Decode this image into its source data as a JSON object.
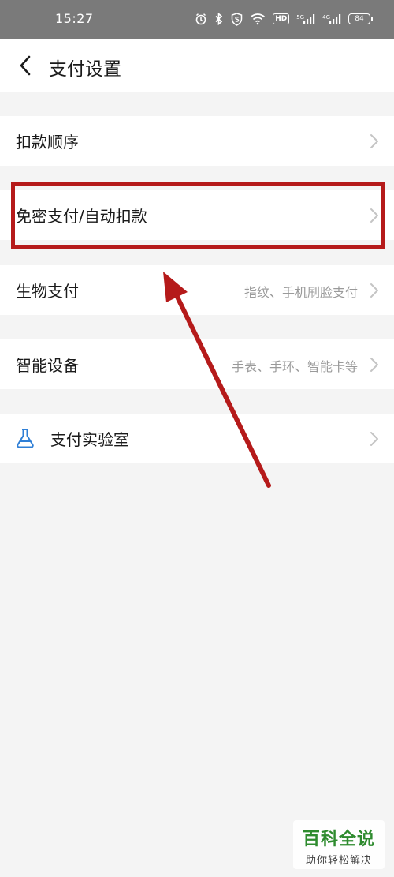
{
  "status_bar": {
    "time": "15:27",
    "network_5g": "5G",
    "network_4g": "4G",
    "hd": "HD",
    "battery": "84",
    "icons": [
      "alarm-icon",
      "bluetooth-icon",
      "shield-s-icon",
      "wifi-icon",
      "hd-icon",
      "signal-5g-icon",
      "signal-4g-icon",
      "battery-icon"
    ]
  },
  "header": {
    "title": "支付设置"
  },
  "settings": {
    "deduction_order": {
      "label": "扣款顺序"
    },
    "auto_pay": {
      "label": "免密支付/自动扣款"
    },
    "bio_pay": {
      "label": "生物支付",
      "detail": "指纹、手机刷脸支付"
    },
    "smart_devices": {
      "label": "智能设备",
      "detail": "手表、手环、智能卡等"
    },
    "pay_lab": {
      "label": "支付实验室",
      "icon": "flask-icon"
    }
  },
  "annotation": {
    "color": "#b51a1a"
  },
  "watermark": {
    "brand": "百科全说",
    "slogan": "助你轻松解决"
  }
}
